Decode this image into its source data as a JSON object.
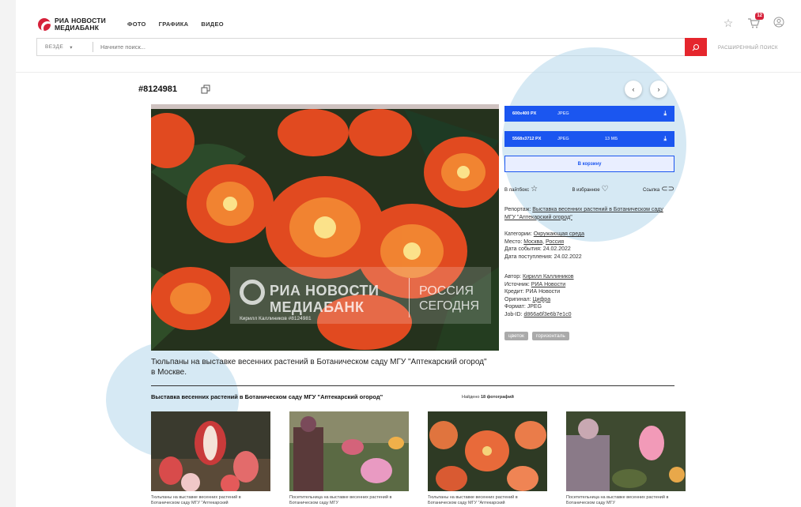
{
  "header": {
    "logo_line1": "РИА НОВОСТИ",
    "logo_line2": "МЕДИАБАНК",
    "nav": [
      "ФОТО",
      "ГРАФИКА",
      "ВИДЕО"
    ],
    "cart_count": "12",
    "search_scope": "ВЕЗДЕ",
    "search_placeholder": "Начните поиск...",
    "advanced_search": "РАСШИРЕННЫЙ ПОИСК"
  },
  "item": {
    "id": "#8124981",
    "caption": "Тюльпаны на выставке весенних растений в Ботаническом саду МГУ \"Аптекарский огород\" в Москве.",
    "watermark": {
      "brand1": "РИА НОВОСТИ",
      "brand2": "МЕДИАБАНК",
      "brand3": "РОССИЯ",
      "brand4": "СЕГОДНЯ",
      "credit": "Кирилл Каллиников #8124981"
    }
  },
  "downloads": [
    {
      "res": "600x400 PX",
      "format": "JPEG",
      "size": ""
    },
    {
      "res": "5568x3712 PX",
      "format": "JPEG",
      "size": "13 МБ"
    }
  ],
  "cart_button": "В корзину",
  "actions": {
    "lightbox": "В лайтбокс",
    "favorites": "В избранное",
    "link": "Ссылка"
  },
  "meta": {
    "report_label": "Репортаж:",
    "report_value": "Выставка весенних растений в Ботаническом саду МГУ \"Аптекарский огород\"",
    "category_label": "Категории:",
    "category_value": "Окружающая среда",
    "place_label": "Место:",
    "place_value1": "Москва",
    "place_value2": "Россия",
    "event_date": "Дата события: 24.02.2022",
    "received_date": "Дата поступления: 24.02.2022",
    "author_label": "Автор:",
    "author_value": "Кирилл Каллиников",
    "source_label": "Источник:",
    "source_value": "РИА Новости",
    "credit": "Кредит: РИА Новости",
    "original_label": "Оригинал:",
    "original_value": "Цифра",
    "format": "Формат: JPEG",
    "job_label": "Job-ID:",
    "job_value": "d866a6f3e6b7e1c0"
  },
  "tags": [
    "цветок",
    "горизонталь"
  ],
  "series": {
    "title": "Выставка весенних растений в Ботаническом саду МГУ \"Аптекарский огород\"",
    "found_label": "Найдено",
    "found_value": "18 фотографий",
    "thumbs": [
      {
        "caption": "Тюльпаны на выставке весенних растений в Ботаническом саду МГУ \"Аптекарский"
      },
      {
        "caption": "Посетительница на выставке весенних растений в Ботаническом саду МГУ"
      },
      {
        "caption": "Тюльпаны на выставке весенних растений в Ботаническом саду МГУ \"Аптекарский"
      },
      {
        "caption": "Посетительница на выставке весенних растений в Ботаническом саду МГУ"
      }
    ]
  }
}
